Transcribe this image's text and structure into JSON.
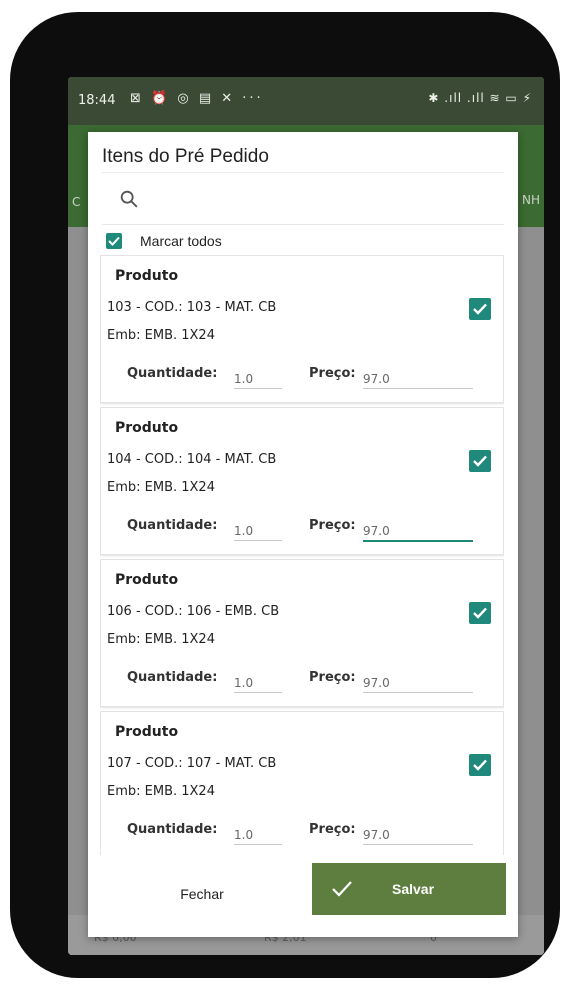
{
  "status_bar": {
    "time": "18:44",
    "left_icons": "⊠ ⏰ ◎ ▤ ✕ ···",
    "right_icons": "✱ .ıll .ıll ≋ ▭ ⚡"
  },
  "background": {
    "left_edge_text": "C",
    "right_edge_text": "NH",
    "footer_values": [
      "R$ 0,00",
      "R$ 2,01",
      "0"
    ]
  },
  "dialog": {
    "title": "Itens do Pré Pedido",
    "search": {
      "placeholder": ""
    },
    "select_all_label": "Marcar todos",
    "select_all_checked": true,
    "items": [
      {
        "title": "Produto",
        "code": "103 - COD.: 103 - MAT. CB",
        "emb": "Emb: EMB. 1X24",
        "checked": true,
        "qty_label": "Quantidade:",
        "qty": "1.0",
        "price_label": "Preço:",
        "price": "97.0"
      },
      {
        "title": "Produto",
        "code": "104 - COD.: 104 - MAT. CB",
        "emb": "Emb: EMB. 1X24",
        "checked": true,
        "qty_label": "Quantidade:",
        "qty": "1.0",
        "price_label": "Preço:",
        "price": "97.0"
      },
      {
        "title": "Produto",
        "code": "106 - COD.: 106 - EMB. CB",
        "emb": "Emb: EMB. 1X24",
        "checked": true,
        "qty_label": "Quantidade:",
        "qty": "1.0",
        "price_label": "Preço:",
        "price": "97.0"
      },
      {
        "title": "Produto",
        "code": "107 - COD.: 107 - MAT. CB",
        "emb": "Emb: EMB. 1X24",
        "checked": true,
        "qty_label": "Quantidade:",
        "qty": "1.0",
        "price_label": "Preço:",
        "price": "97.0"
      }
    ],
    "close_label": "Fechar",
    "save_label": "Salvar"
  },
  "colors": {
    "accent_teal": "#1f8a7c",
    "save_green": "#5e7e3f",
    "appbar_green": "#3b6a32"
  },
  "icons": {
    "search": "search-icon",
    "checkbox": "checkbox-checked-icon",
    "save": "check-icon"
  }
}
